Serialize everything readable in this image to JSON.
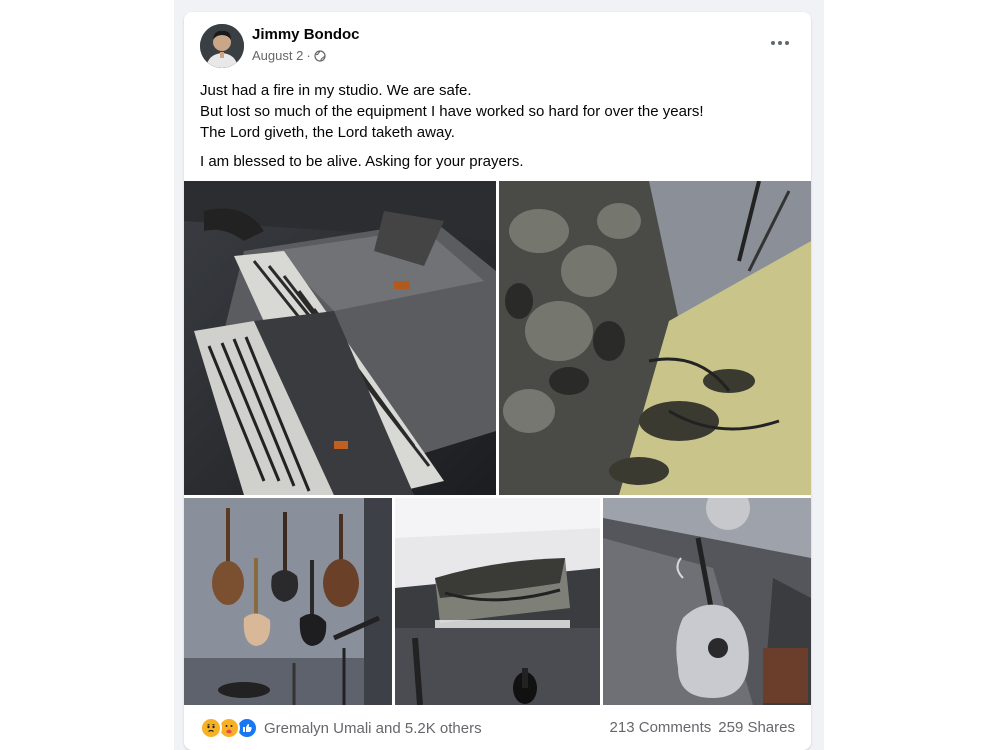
{
  "post": {
    "author": "Jimmy Bondoc",
    "date": "August 2",
    "separator": "·",
    "privacy_icon": "globe-icon",
    "more_icon": "more-options-icon",
    "text_lines": [
      "Just had a fire in my studio. We are safe.",
      "But lost so much of the equipment I have worked so hard for over the years!",
      "The Lord giveth, the Lord taketh away.",
      "I am blessed to be alive. Asking for your prayers."
    ],
    "photos": [
      {
        "subject": "burned-keyboards-photo"
      },
      {
        "subject": "burned-wall-floor-photo"
      },
      {
        "subject": "guitars-wall-photo"
      },
      {
        "subject": "burned-ceiling-unit-photo"
      },
      {
        "subject": "burned-acoustic-guitar-photo"
      }
    ],
    "reactions": {
      "icons": [
        "sad-reaction-icon",
        "care-reaction-icon",
        "like-reaction-icon"
      ],
      "text": "Gremalyn Umali and 5.2K others"
    },
    "comments": "213 Comments",
    "shares": "259 Shares"
  },
  "colors": {
    "background": "#f0f2f5",
    "card": "#ffffff",
    "secondary_text": "#65676b",
    "like_blue": "#1877f2",
    "reaction_yellow": "#f7b125"
  }
}
